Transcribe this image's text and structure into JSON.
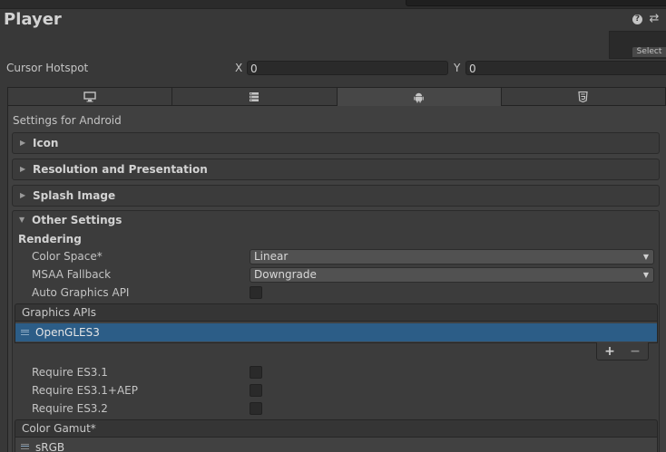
{
  "inspector": {
    "title": "Player",
    "icons": {
      "help": "help-icon",
      "presets": "preset-sliders-icon"
    },
    "select_label": "Select"
  },
  "cursor_hotspot": {
    "label": "Cursor Hotspot",
    "x_label": "X",
    "x_value": "0",
    "y_label": "Y",
    "y_value": "0"
  },
  "platform_tabs": [
    {
      "icon": "desktop-monitor-icon",
      "active": false
    },
    {
      "icon": "server-icon",
      "active": false
    },
    {
      "icon": "android-icon",
      "active": true
    },
    {
      "icon": "html5-icon",
      "active": false
    }
  ],
  "settings_for": "Settings for Android",
  "sections": {
    "icon": "Icon",
    "resolution": "Resolution and Presentation",
    "splash": "Splash Image",
    "other": "Other Settings"
  },
  "rendering": {
    "header": "Rendering",
    "color_space": {
      "label": "Color Space*",
      "value": "Linear"
    },
    "msaa_fallback": {
      "label": "MSAA Fallback",
      "value": "Downgrade"
    },
    "auto_graphics_api": {
      "label": "Auto Graphics API",
      "checked": false
    },
    "graphics_apis": {
      "header": "Graphics APIs",
      "items": [
        "OpenGLES3"
      ]
    },
    "require_es31": {
      "label": "Require ES3.1",
      "checked": false
    },
    "require_es31_aep": {
      "label": "Require ES3.1+AEP",
      "checked": false
    },
    "require_es32": {
      "label": "Require ES3.2",
      "checked": false
    },
    "color_gamut": {
      "header": "Color Gamut*",
      "items": [
        "sRGB"
      ]
    }
  },
  "colors": {
    "background": "#383838",
    "selection": "#2c5d87",
    "field": "#2a2a2a"
  }
}
